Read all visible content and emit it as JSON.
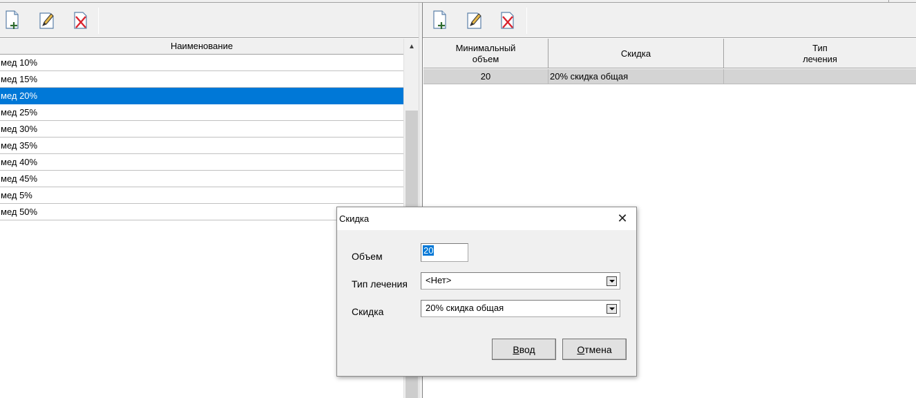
{
  "left_table": {
    "header": "Наименование",
    "rows": [
      "мед 10%",
      "мед 15%",
      "мед 20%",
      "мед 25%",
      "мед 30%",
      "мед 35%",
      "мед 40%",
      "мед 45%",
      "мед 5%",
      "мед 50%"
    ],
    "selected_index": 2
  },
  "right_table": {
    "headers": {
      "min_volume_line1": "Минимальный",
      "min_volume_line2": "объем",
      "discount": "Скидка",
      "treatment_line1": "Тип",
      "treatment_line2": "лечения"
    },
    "row": {
      "min_volume": "20",
      "discount": "20% скидка общая",
      "treatment": ""
    }
  },
  "toolbar": {
    "icons": [
      "add-icon",
      "edit-icon",
      "delete-icon"
    ]
  },
  "dialog": {
    "title": "Скидка",
    "volume_label": "Объем",
    "volume_value": "20",
    "treatment_label": "Тип лечения",
    "treatment_value": "<Нет>",
    "discount_label": "Скидка",
    "discount_value": "20% скидка общая",
    "ok_hotkey": "В",
    "ok_rest": "вод",
    "cancel_hotkey": "О",
    "cancel_rest": "тмена"
  },
  "colors": {
    "selection": "#0078d7",
    "row_highlight": "#d4d4d4",
    "face": "#f0f0f0"
  }
}
